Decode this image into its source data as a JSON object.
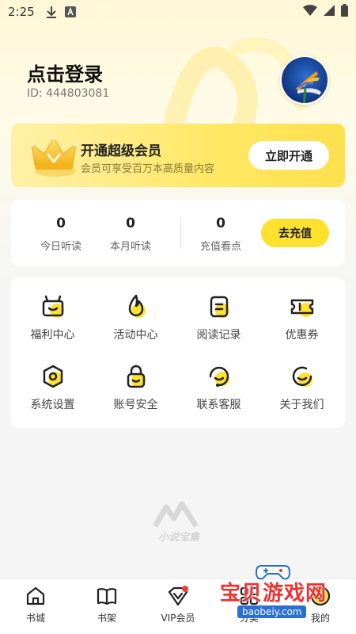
{
  "status_bar": {
    "time": "2:25"
  },
  "profile": {
    "login_text": "点击登录",
    "user_id": "ID: 444803081"
  },
  "vip": {
    "title": "开通超级会员",
    "subtitle": "会员可享受百万本高质量内容",
    "button": "立即开通"
  },
  "stats": {
    "items": [
      {
        "value": "0",
        "label": "今日听读"
      },
      {
        "value": "0",
        "label": "本月听读"
      },
      {
        "value": "0",
        "label": "充值看点"
      }
    ],
    "recharge_button": "去充值"
  },
  "features": [
    {
      "label": "福利中心",
      "icon": "gift-box-icon"
    },
    {
      "label": "活动中心",
      "icon": "flame-icon"
    },
    {
      "label": "阅读记录",
      "icon": "reading-record-icon"
    },
    {
      "label": "优惠券",
      "icon": "coupon-icon"
    },
    {
      "label": "系统设置",
      "icon": "settings-icon"
    },
    {
      "label": "账号安全",
      "icon": "lock-icon"
    },
    {
      "label": "联系客服",
      "icon": "customer-service-icon"
    },
    {
      "label": "关于我们",
      "icon": "smile-icon"
    }
  ],
  "logo_text": "小说宝集",
  "bottom_nav": [
    {
      "label": "书城",
      "icon": "home-icon"
    },
    {
      "label": "书架",
      "icon": "book-icon"
    },
    {
      "label": "VIP会员",
      "icon": "vip-diamond-icon"
    },
    {
      "label": "分类",
      "icon": "category-icon"
    },
    {
      "label": "我的",
      "icon": "profile-icon"
    }
  ],
  "watermark": {
    "text": "宝贝游戏网",
    "url": "baobeiy.com"
  },
  "colors": {
    "accent": "#ffe12e",
    "vip_gradient_start": "#fff0a8",
    "vip_gradient_end": "#ffe04d",
    "badge_red": "#ff3b30"
  }
}
